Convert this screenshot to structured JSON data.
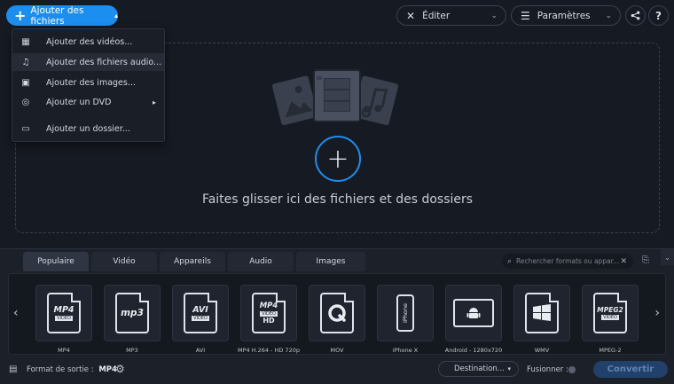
{
  "toolbar": {
    "add_files_label": "Ajouter des fichiers",
    "edit_label": "Éditer",
    "settings_label": "Paramètres",
    "help_label": "?"
  },
  "add_menu": {
    "items": [
      {
        "label": "Ajouter des vidéos...",
        "icon": "video-icon"
      },
      {
        "label": "Ajouter des fichiers audio...",
        "icon": "music-note-icon",
        "highlighted": true
      },
      {
        "label": "Ajouter des images...",
        "icon": "image-icon"
      },
      {
        "label": "Ajouter un DVD",
        "icon": "dvd-icon",
        "submenu": true
      },
      {
        "label": "Ajouter un dossier...",
        "icon": "folder-icon"
      }
    ]
  },
  "dropzone": {
    "text": "Faites glisser ici des fichiers et des dossiers"
  },
  "format_tabs": {
    "tabs": [
      "Populaire",
      "Vidéo",
      "Appareils",
      "Audio",
      "Images"
    ],
    "active": "Populaire"
  },
  "search": {
    "placeholder": "Rechercher formats ou appar..."
  },
  "formats": [
    {
      "name": "MP4",
      "label": "MP4",
      "icon": "mp4-icon"
    },
    {
      "name": "MP3",
      "label": "MP3",
      "icon": "mp3-icon"
    },
    {
      "name": "AVI",
      "label": "AVI",
      "icon": "avi-icon"
    },
    {
      "name": "MP4 HD",
      "label": "MP4 H.264 - HD 720p",
      "icon": "mp4-hd-icon"
    },
    {
      "name": "MOV",
      "label": "MOV",
      "icon": "quicktime-icon"
    },
    {
      "name": "iPhone",
      "label": "iPhone X",
      "icon": "iphone-icon"
    },
    {
      "name": "Android",
      "label": "Android - 1280x720",
      "icon": "android-icon"
    },
    {
      "name": "WMV",
      "label": "WMV",
      "icon": "windows-icon"
    },
    {
      "name": "MPEG2",
      "label": "MPEG-2",
      "icon": "mpeg2-icon"
    }
  ],
  "format_icon_text": {
    "mp4": "MP4",
    "mp4_sub": "VIDEO",
    "mp3": "mp3",
    "avi": "AVI",
    "avi_sub": "VIDEO",
    "mp4hd": "MP4",
    "mp4hd_sub": "VIDEO",
    "mp4hd_hd": "HD",
    "iphone": "iPhone",
    "mpeg2": "MPEG2",
    "mpeg2_sub": "VIDEO"
  },
  "footer": {
    "output_label": "Format de sortie :",
    "output_value": "MP4",
    "destination_label": "Destination...",
    "merge_label": "Fusionner :",
    "convert_label": "Convertir"
  },
  "colors": {
    "accent": "#1c8ef0",
    "background": "#161a22",
    "convert_disabled": "#21406a"
  }
}
